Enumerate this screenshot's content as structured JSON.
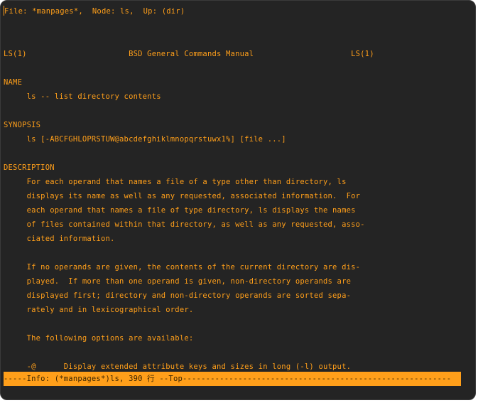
{
  "header": {
    "line": "File: *manpages*,  Node: ls,  Up: (dir)"
  },
  "man": {
    "title_line": "LS(1)                      BSD General Commands Manual                     LS(1)",
    "name_heading": "NAME",
    "name_text": "     ls -- list directory contents",
    "synopsis_heading": "SYNOPSIS",
    "synopsis_text": "     ls [-ABCFGHLOPRSTUW@abcdefghiklmnopqrstuwx1%] [file ...]",
    "description_heading": "DESCRIPTION",
    "description_lines": [
      "     For each operand that names a file of a type other than directory, ls",
      "     displays its name as well as any requested, associated information.  For",
      "     each operand that names a file of type directory, ls displays the names",
      "     of files contained within that directory, as well as any requested, asso-",
      "     ciated information."
    ],
    "paragraph2_lines": [
      "     If no operands are given, the contents of the current directory are dis-",
      "     played.  If more than one operand is given, non-directory operands are",
      "     displayed first; directory and non-directory operands are sorted sepa-",
      "     rately and in lexicographical order."
    ],
    "options_intro": "     The following options are available:",
    "option_at": "     -@      Display extended attribute keys and sizes in long (-l) output."
  },
  "status_bar": {
    "text": "-----Info: (*manpages*)ls, 390 行 --Top----------------------------------------------------------"
  },
  "colors": {
    "background": "#242424",
    "foreground": "#ff9f1a",
    "status_background": "#ff9f1a",
    "status_foreground": "#3b2400"
  }
}
